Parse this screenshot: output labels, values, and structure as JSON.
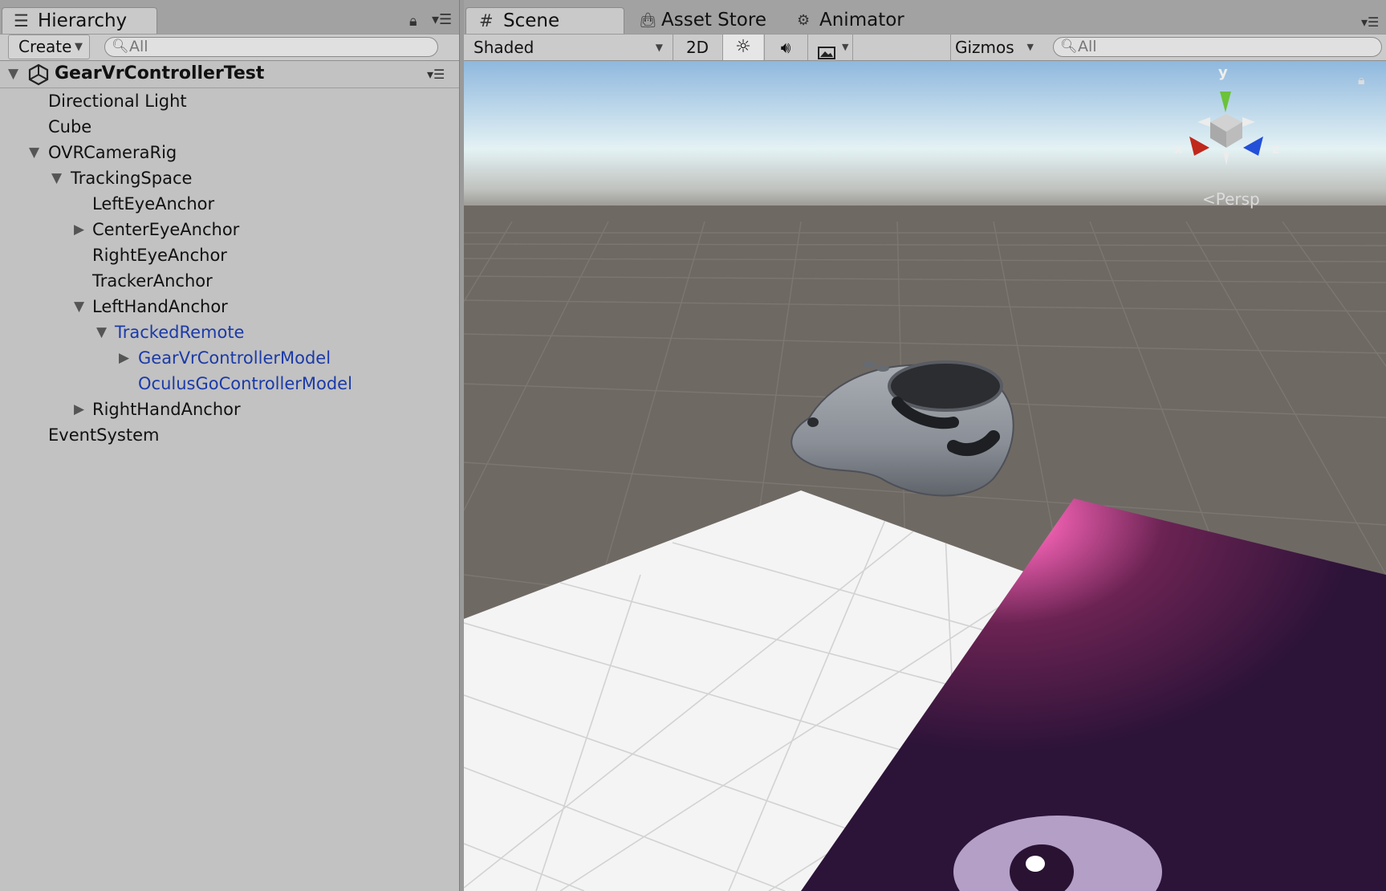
{
  "hierarchy": {
    "tab_label": "Hierarchy",
    "create_label": "Create",
    "search_placeholder": "All",
    "scene_name": "GearVrControllerTest",
    "items": [
      {
        "label": "Directional Light",
        "arrow": ""
      },
      {
        "label": "Cube",
        "arrow": ""
      },
      {
        "label": "OVRCameraRig",
        "arrow": "expanded"
      },
      {
        "label": "TrackingSpace",
        "arrow": "expanded"
      },
      {
        "label": "LeftEyeAnchor",
        "arrow": ""
      },
      {
        "label": "CenterEyeAnchor",
        "arrow": "collapsed"
      },
      {
        "label": "RightEyeAnchor",
        "arrow": ""
      },
      {
        "label": "TrackerAnchor",
        "arrow": ""
      },
      {
        "label": "LeftHandAnchor",
        "arrow": "expanded"
      },
      {
        "label": "TrackedRemote",
        "arrow": "expanded",
        "color": "#1b3aa8"
      },
      {
        "label": "GearVrControllerModel",
        "arrow": "collapsed",
        "color": "#1b3aa8"
      },
      {
        "label": "OculusGoControllerModel",
        "arrow": "",
        "color": "#1b3aa8"
      },
      {
        "label": "RightHandAnchor",
        "arrow": "collapsed"
      },
      {
        "label": "EventSystem",
        "arrow": ""
      }
    ]
  },
  "scene": {
    "tabs": [
      {
        "label": "Scene",
        "icon": "grid-icon",
        "active": true
      },
      {
        "label": "Asset Store",
        "icon": "shopping-bag-icon",
        "active": false
      },
      {
        "label": "Animator",
        "icon": "animator-icon",
        "active": false
      }
    ],
    "toolbar": {
      "draw_mode": "Shaded",
      "toggle_2d": "2D",
      "lighting_icon": "sun-icon",
      "audio_icon": "speaker-icon",
      "effects_icon": "image-icon",
      "gizmos_label": "Gizmos",
      "search_placeholder": "All"
    },
    "gizmo": {
      "axis_x": "x",
      "axis_y": "y",
      "axis_z": "z",
      "projection_label": "Persp",
      "colors": {
        "x": "#c0281c",
        "y": "#6cc23a",
        "z": "#2350d8"
      }
    }
  },
  "colors": {
    "panel_bg": "#c2c2c2",
    "tab_bar_bg": "#a2a2a2",
    "selected_text": "#1b3aa8",
    "ground": "#6f6964",
    "sky_top": "#8fb8de"
  }
}
